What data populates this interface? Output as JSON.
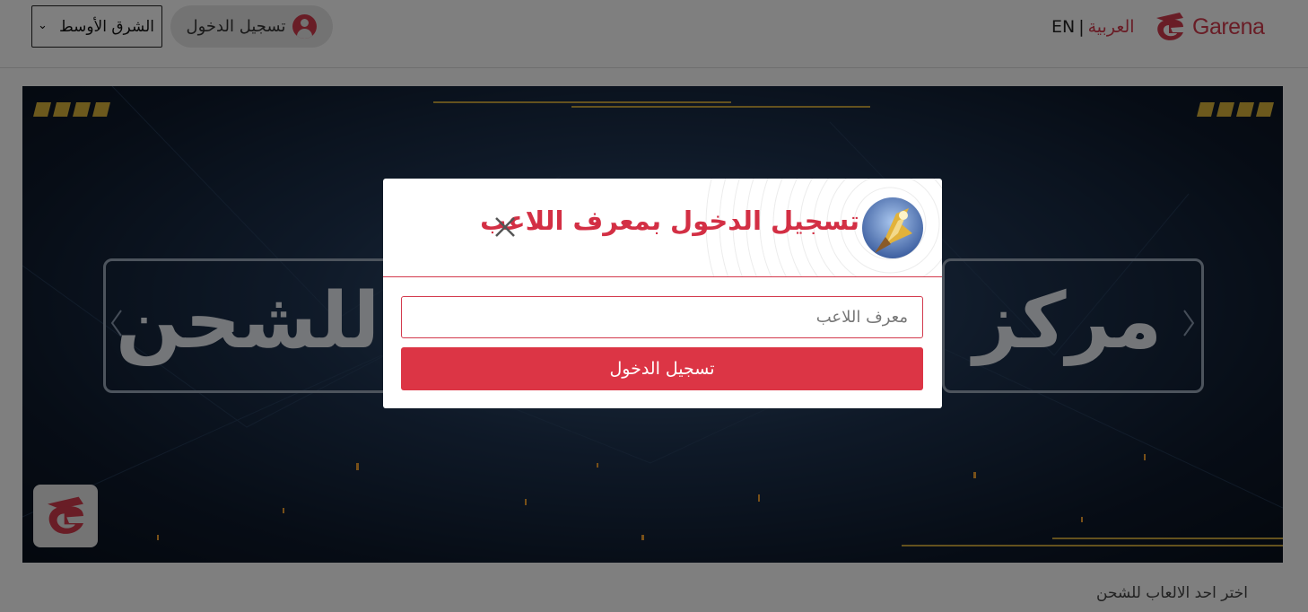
{
  "header": {
    "brand": "Garena",
    "lang_ar": "العربية",
    "lang_sep": "|",
    "lang_en": "EN",
    "login_label": "تسجيل الدخول",
    "region_selected": "الشرق الأوسط"
  },
  "banner": {
    "text_left": "للشحن",
    "text_right": "مركز"
  },
  "main": {
    "choose_game_label": "اختر احد الالعاب للشحن"
  },
  "modal": {
    "title": "تسجيل الدخول بمعرف اللاعب",
    "input_placeholder": "معرف اللاعب",
    "input_value": "",
    "submit_label": "تسجيل الدخول"
  },
  "colors": {
    "brand_red": "#d33a4d",
    "button_red": "#dc3545",
    "overlay": "rgba(0,0,0,0.5)"
  },
  "icons": [
    "garena-logo-icon",
    "user-circle-icon",
    "chevron-down-icon",
    "close-icon",
    "player-avatar"
  ]
}
